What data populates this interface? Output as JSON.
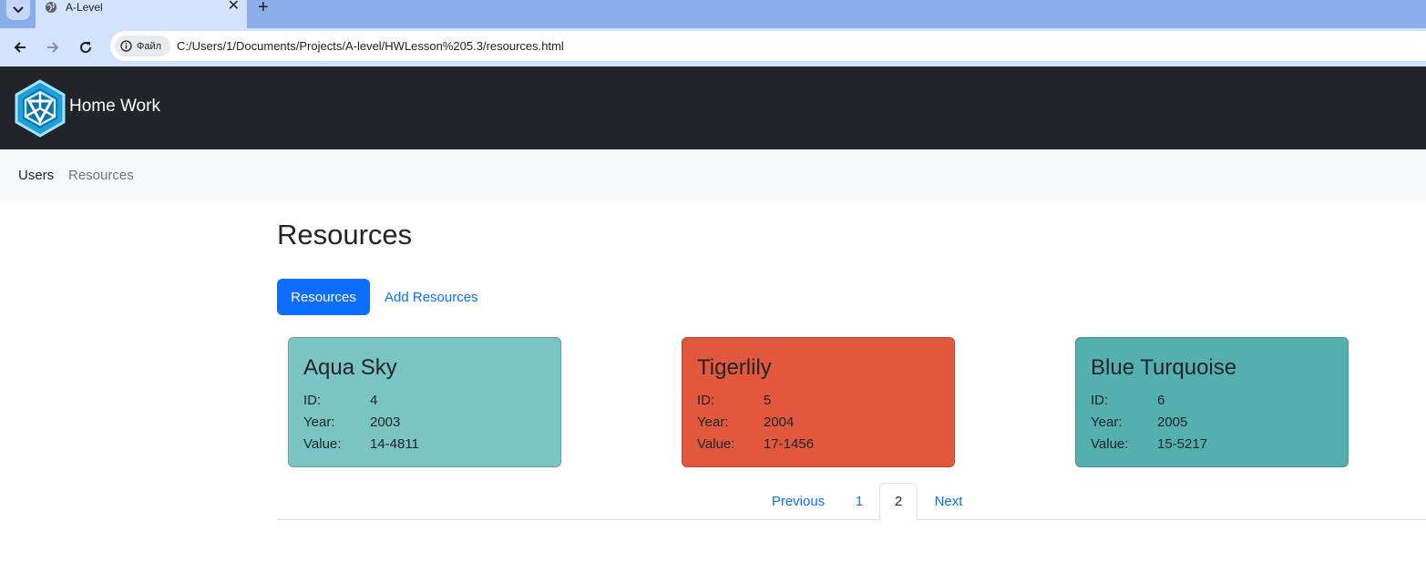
{
  "browser": {
    "tab_title": "A-Level",
    "tab_close": "✕",
    "new_tab": "+",
    "site_chip": "Файл",
    "url": "C:/Users/1/Documents/Projects/A-level/HWLesson%205.3/resources.html"
  },
  "navbar": {
    "brand": "Home Work",
    "bg_color": "#212529"
  },
  "subnav": {
    "items": [
      {
        "label": "Users",
        "active": true
      },
      {
        "label": "Resources",
        "active": false
      }
    ]
  },
  "page": {
    "title": "Resources",
    "pills": [
      {
        "label": "Resources",
        "active": true
      },
      {
        "label": "Add Resources",
        "active": false
      }
    ]
  },
  "cards": [
    {
      "name": "Aqua Sky",
      "color": "#7bc4c4",
      "id_label": "ID:",
      "id": "4",
      "year_label": "Year:",
      "year": "2003",
      "value_label": "Value:",
      "value": "14-4811"
    },
    {
      "name": "Tigerlily",
      "color": "#e2583e",
      "id_label": "ID:",
      "id": "5",
      "year_label": "Year:",
      "year": "2004",
      "value_label": "Value:",
      "value": "17-1456"
    },
    {
      "name": "Blue Turquoise",
      "color": "#53b0ae",
      "id_label": "ID:",
      "id": "6",
      "year_label": "Year:",
      "year": "2005",
      "value_label": "Value:",
      "value": "15-5217"
    }
  ],
  "pagination": {
    "previous": "Previous",
    "pages": [
      "1",
      "2"
    ],
    "current": "2",
    "next": "Next"
  }
}
